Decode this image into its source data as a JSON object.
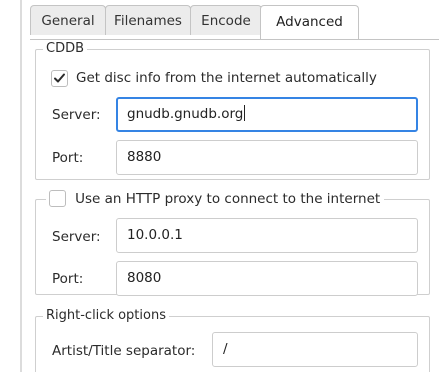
{
  "tabs": [
    {
      "label": "General"
    },
    {
      "label": "Filenames"
    },
    {
      "label": "Encode"
    },
    {
      "label": "Advanced",
      "active": true
    }
  ],
  "cddb": {
    "title": "CDDB",
    "auto_lookup_label": "Get disc info from the internet automatically",
    "auto_lookup_checked": true,
    "server_label": "Server:",
    "server_value": "gnudb.gnudb.org",
    "port_label": "Port:",
    "port_value": "8880"
  },
  "proxy": {
    "use_proxy_label": "Use an HTTP proxy to connect to the internet",
    "use_proxy_checked": false,
    "server_label": "Server:",
    "server_value": "10.0.0.1",
    "port_label": "Port:",
    "port_value": "8080"
  },
  "right_click": {
    "title": "Right-click options",
    "separator_label": "Artist/Title separator:",
    "separator_value": "/"
  },
  "colors": {
    "focus_accent": "#3584e4",
    "frame_border": "#cfcfcf",
    "tab_inactive_bg": "#ececec"
  }
}
